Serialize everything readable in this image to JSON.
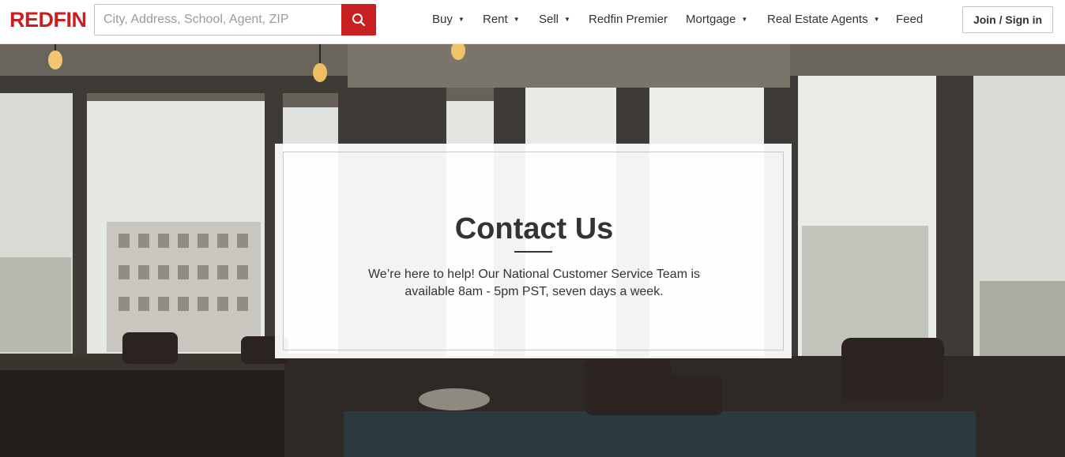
{
  "brand": {
    "logo_text": "REDFIN",
    "accent_color": "#c82021"
  },
  "search": {
    "placeholder": "City, Address, School, Agent, ZIP",
    "value": "",
    "button_icon": "search-icon"
  },
  "nav": {
    "items": [
      {
        "label": "Buy",
        "has_dropdown": true
      },
      {
        "label": "Rent",
        "has_dropdown": true
      },
      {
        "label": "Sell",
        "has_dropdown": true
      },
      {
        "label": "Redfin Premier",
        "has_dropdown": false
      },
      {
        "label": "Mortgage",
        "has_dropdown": true
      },
      {
        "label": "Real Estate Agents",
        "has_dropdown": true
      },
      {
        "label": "Feed",
        "has_dropdown": false
      }
    ],
    "caret": "▼"
  },
  "auth": {
    "join_label": "Join / Sign in"
  },
  "contact": {
    "title": "Contact Us",
    "description": "We’re here to help! Our National Customer Service Team is available 8am - 5pm PST, seven days a week."
  }
}
